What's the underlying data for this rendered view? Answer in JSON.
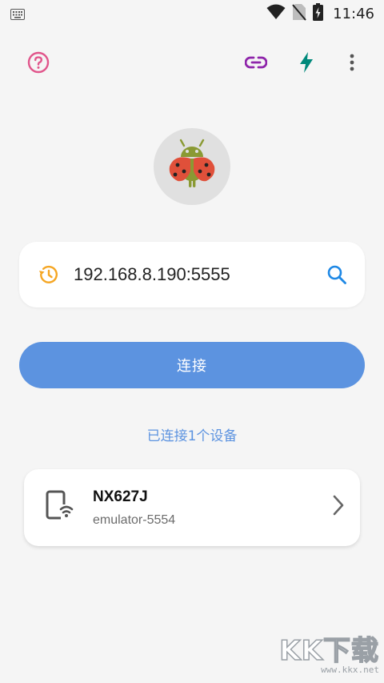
{
  "status_bar": {
    "time": "11:46",
    "icons": [
      "keyboard-icon",
      "wifi-icon",
      "no-sim-icon",
      "battery-charging-icon"
    ]
  },
  "toolbar": {
    "help_icon": "help-circle-icon",
    "link_icon": "link-icon",
    "flash_icon": "flash-icon",
    "menu_icon": "more-vert-icon"
  },
  "app": {
    "logo_icon": "ladybug-android-icon"
  },
  "address": {
    "history_icon": "history-icon",
    "value": "192.168.8.190:5555",
    "search_icon": "search-icon"
  },
  "connect_button": {
    "label": "连接"
  },
  "connection_status": "已连接1个设备",
  "devices": [
    {
      "icon": "phone-wifi-icon",
      "name": "NX627J",
      "serial": "emulator-5554"
    }
  ],
  "watermark": {
    "logo": "KK下载",
    "url": "www.kkx.net"
  },
  "colors": {
    "background": "#f5f5f5",
    "accent_blue": "#5c93e0",
    "help_pink": "#e1558b",
    "link_purple": "#8e24aa",
    "flash_teal": "#00897b",
    "history_orange": "#f5a623",
    "search_blue": "#1e88e5"
  }
}
